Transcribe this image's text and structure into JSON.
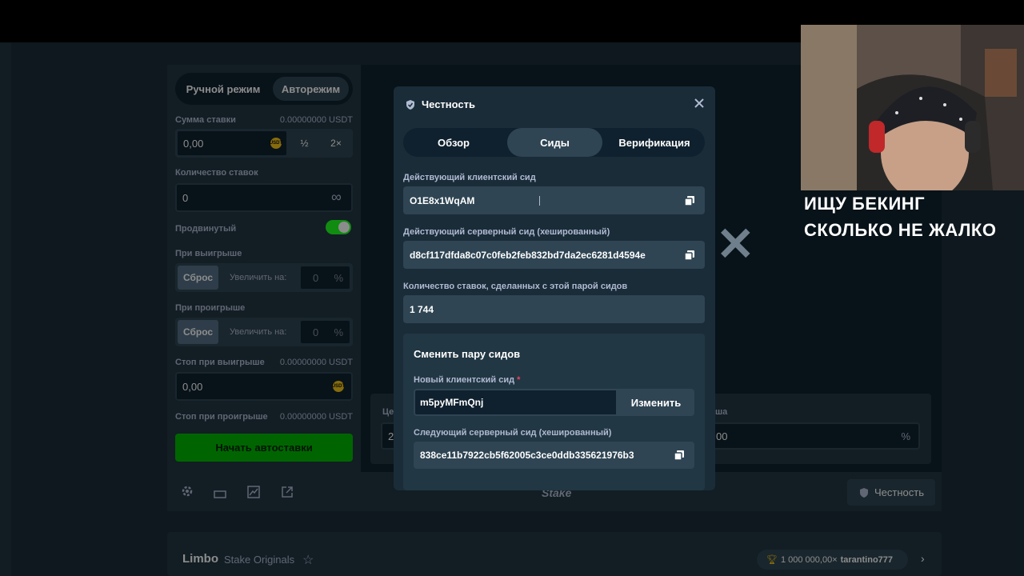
{
  "sidebar": {
    "mode_manual": "Ручной режим",
    "mode_auto": "Авторежим",
    "bet_amount_label": "Сумма ставки",
    "bet_amount_usdt": "0.00000000 USDT",
    "bet_amount_value": "0,00",
    "half_label": "½",
    "double_label": "2×",
    "bets_count_label": "Количество ставок",
    "bets_count_value": "0",
    "infinity_symbol": "∞",
    "advanced_label": "Продвинутый",
    "on_win_label": "При выигрыше",
    "on_loss_label": "При проигрыше",
    "reset_label": "Сброс",
    "increase_label": "Увеличить на:",
    "increase_value": "0",
    "percent_symbol": "%",
    "stop_win_label": "Стоп при выигрыше",
    "stop_win_usdt": "0.00000000 USDT",
    "stop_win_value": "0,00",
    "stop_loss_label": "Стоп при проигрыше",
    "stop_loss_usdt": "0.00000000 USDT",
    "start_button": "Начать автоставки",
    "coin_label": "USDT"
  },
  "game_area": {
    "partial_left_label": "Це",
    "partial_left_value": "2",
    "partial_right_label": "ша",
    "partial_right_value": "00",
    "percent_symbol": "%",
    "big_x": "✕"
  },
  "footer": {
    "logo": "Stake",
    "fairness_button": "Честность"
  },
  "lower_card": {
    "game_name": "Limbo",
    "provider": "Stake Originals",
    "top_win": "1 000 000,00×",
    "top_user": "tarantino777"
  },
  "modal": {
    "title": "Честность",
    "tabs": [
      "Обзор",
      "Сиды",
      "Верификация"
    ],
    "client_seed_label": "Действующий клиентский сид",
    "client_seed_value": "O1E8x1WqAM",
    "server_seed_label": "Действующий серверный сид (хешированный)",
    "server_seed_value": "d8cf117dfda8c07c0feb2feb832bd7da2ec6281d4594e",
    "bets_made_label": "Количество ставок, сделанных с этой парой сидов",
    "bets_made_value": "1 744",
    "change_pair_title": "Сменить пару сидов",
    "new_client_seed_label": "Новый клиентский сид",
    "required_mark": "*",
    "new_client_seed_value": "m5pyMFmQnj",
    "change_button": "Изменить",
    "next_server_seed_label": "Следующий серверный сид (хешированный)",
    "next_server_seed_value": "838ce11b7922cb5f62005c3ce0ddb335621976b3"
  },
  "stream_overlay": {
    "line1": "ИЩУ БЕКИНГ",
    "line2": "СКОЛЬКО НЕ ЖАЛКО"
  },
  "colors": {
    "bg": "#1a2c38",
    "panel": "#213743",
    "dark": "#0f212e",
    "accent_green": "#00b801",
    "toggle_green": "#1fff20"
  }
}
